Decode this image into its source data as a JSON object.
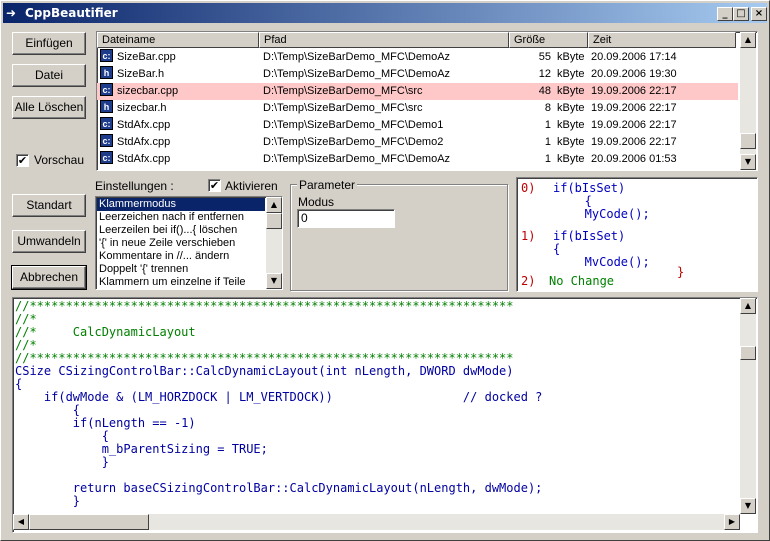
{
  "window": {
    "title": "CppBeautifier",
    "minimize": "_",
    "maximize": "□",
    "close": "×"
  },
  "buttons": {
    "insert": "Einfügen",
    "file": "Datei",
    "clear_all": "Alle Löschen",
    "default": "Standart",
    "convert": "Umwandeln",
    "cancel": "Abbrechen"
  },
  "preview_checkbox": {
    "label": "Vorschau",
    "checked": "✔"
  },
  "file_list": {
    "columns": [
      "Dateiname",
      "Pfad",
      "Größe",
      "Zeit"
    ],
    "rows": [
      {
        "icon": "c:",
        "name": "SizeBar.cpp",
        "path": "D:\\Temp\\SizeBarDemo_MFC\\DemoAz",
        "size": "55",
        "unit": "kByte",
        "time": "20.09.2006 17:14",
        "selected": false
      },
      {
        "icon": "h",
        "name": "SizeBar.h",
        "path": "D:\\Temp\\SizeBarDemo_MFC\\DemoAz",
        "size": "12",
        "unit": "kByte",
        "time": "20.09.2006 19:30",
        "selected": false
      },
      {
        "icon": "c:",
        "name": "sizecbar.cpp",
        "path": "D:\\Temp\\SizeBarDemo_MFC\\src",
        "size": "48",
        "unit": "kByte",
        "time": "19.09.2006 22:17",
        "selected": true
      },
      {
        "icon": "h",
        "name": "sizecbar.h",
        "path": "D:\\Temp\\SizeBarDemo_MFC\\src",
        "size": "8",
        "unit": "kByte",
        "time": "19.09.2006 22:17",
        "selected": false
      },
      {
        "icon": "c:",
        "name": "StdAfx.cpp",
        "path": "D:\\Temp\\SizeBarDemo_MFC\\Demo1",
        "size": "1",
        "unit": "kByte",
        "time": "19.09.2006 22:17",
        "selected": false
      },
      {
        "icon": "c:",
        "name": "StdAfx.cpp",
        "path": "D:\\Temp\\SizeBarDemo_MFC\\Demo2",
        "size": "1",
        "unit": "kByte",
        "time": "19.09.2006 22:17",
        "selected": false
      },
      {
        "icon": "c:",
        "name": "StdAfx.cpp",
        "path": "D:\\Temp\\SizeBarDemo_MFC\\DemoAz",
        "size": "1",
        "unit": "kByte",
        "time": "20.09.2006 01:53",
        "selected": false
      }
    ]
  },
  "settings": {
    "label": "Einstellungen :",
    "activate_label": "Aktivieren",
    "activate_checked": "✔",
    "items": [
      "Klammermodus",
      "Leerzeichen nach if entfernen",
      "Leerzeilen bei if()...{ löschen",
      "'{' in neue Zeile verschieben",
      "Kommentare in //... ändern",
      "Doppelt '{' trennen",
      "Klammern um einzelne if Teile"
    ],
    "selected_index": 0
  },
  "parameter": {
    "group_label": "Parameter",
    "field_label": "Modus",
    "field_value": "0"
  },
  "preview_options": [
    {
      "index": "0)",
      "lines": [
        "if(bIsSet)",
        "   {",
        "   MyCode();"
      ]
    },
    {
      "index": "1)",
      "lines": [
        "if(bIsSet)",
        "{",
        "   MvCode();",
        "}"
      ]
    },
    {
      "index": "2)",
      "lines": [
        "No Change"
      ]
    }
  ],
  "code": {
    "lines": [
      "//*******************************************************************",
      "//*",
      "//*     CalcDynamicLayout",
      "//*",
      "//*******************************************************************",
      "CSize CSizingControlBar::CalcDynamicLayout(int nLength, DWORD dwMode)",
      "{",
      "    if(dwMode & (LM_HORZDOCK | LM_VERTDOCK))                  // docked ?",
      "        {",
      "        if(nLength == -1)",
      "            {",
      "            m_bParentSizing = TRUE;",
      "            }",
      "",
      "        return baseCSizingControlBar::CalcDynamicLayout(nLength, dwMode);",
      "        }"
    ]
  }
}
